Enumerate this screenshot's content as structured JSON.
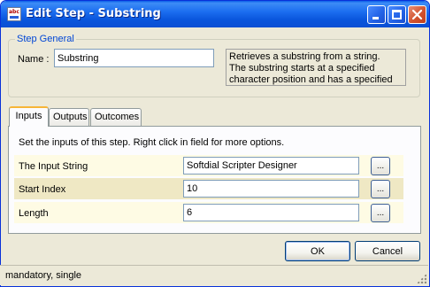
{
  "window": {
    "title": "Edit Step - Substring",
    "icon": "abc-icon",
    "icon_text": "abc"
  },
  "colors": {
    "titlebar": "#0a56dd",
    "group_legend": "#0046d5",
    "row_alt": "#efe8c4",
    "row": "#fefbe4",
    "close_button": "#d2532f"
  },
  "step_general": {
    "legend": "Step General",
    "name_label": "Name :",
    "name_value": "Substring",
    "description_lines": [
      "Retrieves a substring from a string.",
      "The substring starts at a specified",
      "character position and has a specified"
    ]
  },
  "tabs": [
    {
      "label": "Inputs",
      "selected": true
    },
    {
      "label": "Outputs",
      "selected": false
    },
    {
      "label": "Outcomes",
      "selected": false
    }
  ],
  "inputs_panel": {
    "instructions": "Set the inputs of this step.  Right click in field for more options.",
    "rows": [
      {
        "label": "The Input String",
        "value": "Softdial Scripter Designer",
        "button": "..."
      },
      {
        "label": "Start Index",
        "value": "10",
        "button": "..."
      },
      {
        "label": "Length",
        "value": "6",
        "button": "..."
      }
    ]
  },
  "buttons": {
    "ok": "OK",
    "cancel": "Cancel"
  },
  "status": {
    "text": "mandatory, single"
  }
}
